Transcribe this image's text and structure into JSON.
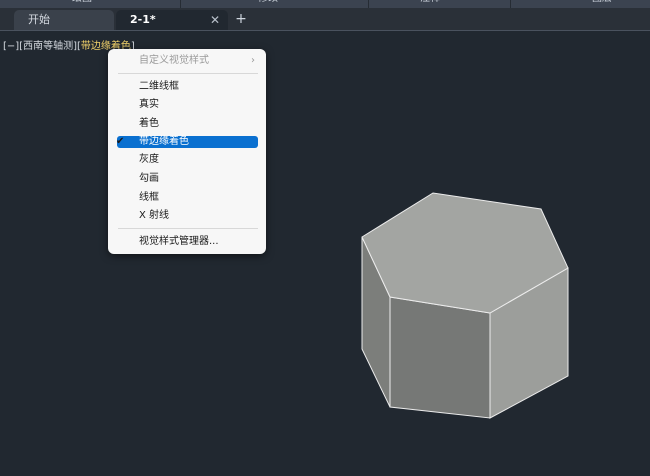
{
  "ribbon": {
    "tabs": [
      "绘图",
      "修改",
      "注释",
      "图层"
    ]
  },
  "file_tabs": [
    {
      "label": "开始",
      "active": false
    },
    {
      "label": "2-1*",
      "active": true
    }
  ],
  "tab_close_icon": "close-icon",
  "add_tab_label": "+",
  "viewport": {
    "prefix": "[−][西南等轴测][",
    "style": "带边缘着色",
    "suffix": "]"
  },
  "context_menu": {
    "header": "自定义视觉样式",
    "items": [
      "二维线框",
      "真实",
      "着色",
      "带边缘着色",
      "灰度",
      "勾画",
      "线框",
      "X 射线"
    ],
    "selected": "带边缘着色",
    "footer": "视觉样式管理器..."
  },
  "colors": {
    "canvas": "#212830",
    "accent": "#0a70d0",
    "highlight": "#f2d36a"
  }
}
